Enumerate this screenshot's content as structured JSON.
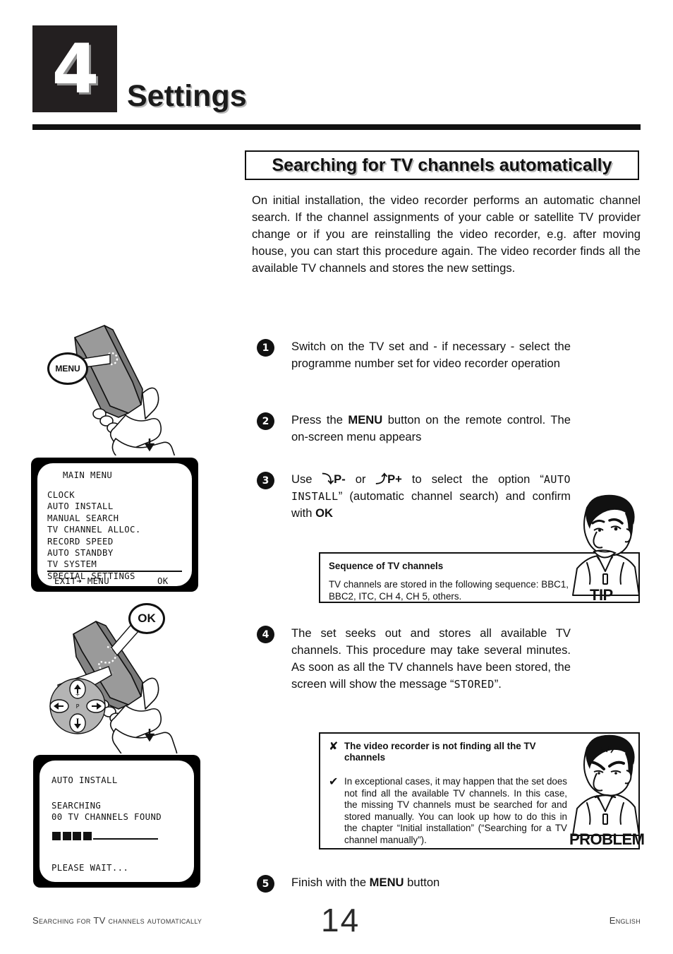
{
  "header": {
    "chapter_number": "4",
    "chapter_title": "Settings",
    "section_banner": "Searching for TV channels automatically"
  },
  "intro": "On initial installation, the video recorder performs an automatic channel search. If the channel assignments of your cable or satellite TV provider change or if you are reinstalling the video recorder, e.g. after moving house, you can start this procedure again. The video recorder finds all the available TV channels and stores the new settings.",
  "steps": [
    {
      "number": "1",
      "text_html": "Switch on the TV set and - if necessary - select the programme number set for video recorder operation"
    },
    {
      "number": "2",
      "text_html": "Press the <b class=\"kb\">MENU</b> button on the remote control. The on-screen menu appears"
    },
    {
      "number": "3",
      "text_html": "Use <span class=\"arrow\">&#10549;</span><b class=\"kb\">P-</b> or <span class=\"arrow\">&#10548;</span><b class=\"kb\">P+</b> to select the option &ldquo;<span class=\"mono\">AUTO INSTALL</span>&rdquo; (automatic channel search) and confirm with <b class=\"kb\">OK</b>"
    },
    {
      "number": "4",
      "text_html": "The set seeks out and stores all available TV channels. This procedure may take several minutes. As soon as all the TV channels have been stored, the screen will show the message &ldquo;<span class=\"mono\">STORED</span>&rdquo;."
    },
    {
      "number": "5",
      "text_html": "Finish with the <b class=\"kb\">MENU</b> button"
    }
  ],
  "tv_screen_main_menu": {
    "title": "MAIN MENU",
    "items": [
      "CLOCK",
      "AUTO INSTALL",
      "MANUAL SEARCH",
      "TV CHANNEL ALLOC.",
      "RECORD SPEED",
      "AUTO STANDBY",
      "TV SYSTEM",
      "SPECIAL SETTINGS"
    ],
    "footer_left": "EXIT➜ MENU",
    "footer_right": "OK"
  },
  "tv_screen_auto_install": {
    "title": "AUTO INSTALL",
    "status": "SEARCHING",
    "channels_found": "00 TV CHANNELS FOUND",
    "progress_blocks_filled": 4,
    "progress_blocks_total": 12,
    "wait_message": "PLEASE WAIT..."
  },
  "illustrations": {
    "remote_menu": {
      "callout_label": "MENU"
    },
    "remote_ok": {
      "callout_label": "OK",
      "dpad_center_label": "P",
      "dpad_up": "+",
      "dpad_down": "–"
    }
  },
  "tip_box": {
    "badge": "TIP",
    "title": "Sequence of TV channels",
    "body": "TV channels are stored in the following sequence: BBC1, BBC2, ITC, CH 4, CH 5, others."
  },
  "problem_box": {
    "badge": "PROBLEM",
    "problem_mark": "✘",
    "solution_mark": "✔",
    "problem_title": "The video recorder is not finding all the TV channels",
    "solution_body": "In exceptional cases, it may happen that the set does not find all the available TV channels. In this case, the missing TV channels must be searched for and stored manually. You can look up how to do this in the chapter “Initial installation” (“Searching for a TV channel manually”)."
  },
  "footer": {
    "left": "Searching for TV channels automatically",
    "page_number": "14",
    "right": "English"
  },
  "colors": {
    "ink": "#111111",
    "badge_bg": "#231f20",
    "shadow": "#bdbdbd",
    "remote_body": "#8f8f8f",
    "remote_dark": "#6d6d6d"
  }
}
